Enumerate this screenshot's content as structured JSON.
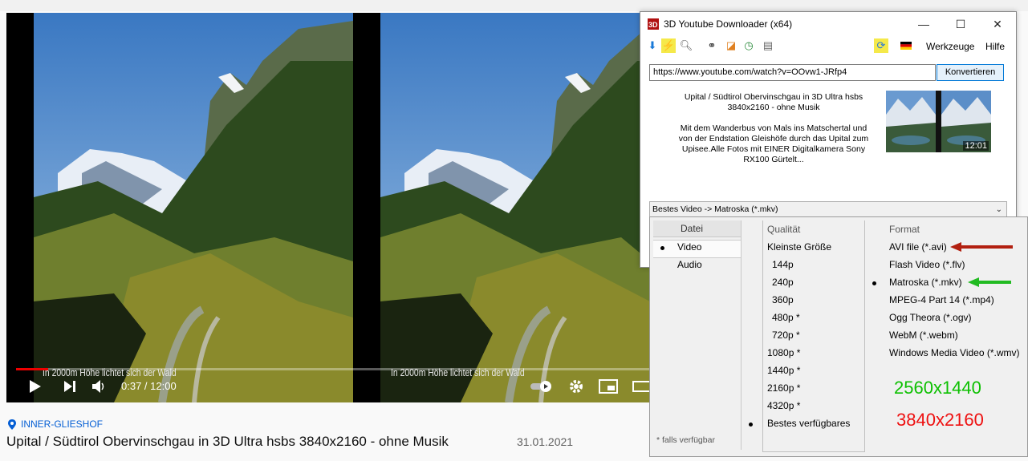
{
  "youtube": {
    "caption": "In 2000m Höhe lichtet sich der Wald",
    "time_display": "0:37 / 12:00",
    "progress": 0.051,
    "location": "INNER-GLIESHOF",
    "title": "Upital / Südtirol Obervinschgau in 3D Ultra hsbs 3840x2160 - ohne Musik",
    "date": "31.01.2021"
  },
  "app": {
    "title": "3D Youtube Downloader (x64)",
    "window_buttons": {
      "minimize": "—",
      "maximize": "☐",
      "close": "✕"
    },
    "menu": {
      "tools": "Werkzeuge",
      "help": "Hilfe"
    },
    "url": "https://www.youtube.com/watch?v=OOvw1-JRfp4",
    "convert_label": "Konvertieren",
    "description_lines": [
      "Upital / Südtirol Obervinschgau in 3D Ultra hsbs",
      "3840x2160 - ohne Musik",
      "",
      "Mit dem Wanderbus von Mals ins Matschertal und",
      "von der Endstation Gleishöfe durch das Upital zum",
      "Upisee.Alle Fotos mit EINER Digitalkamera Sony",
      "RX100 Gürtelt..."
    ],
    "thumb_duration": "12:01",
    "format_selected": "Bestes Video -> Matroska (*.mkv)"
  },
  "dropdown": {
    "datei_header": "Datei",
    "datei_options": [
      "Video",
      "Audio"
    ],
    "datei_selected": "Video",
    "quality_header": "Qualität",
    "quality_options": [
      "Kleinste Größe",
      "144p",
      "240p",
      "360p",
      "480p *",
      "720p *",
      "1080p *",
      "1440p *",
      "2160p *",
      "4320p *",
      "Bestes verfügbares"
    ],
    "quality_selected": "Bestes verfügbares",
    "format_header": "Format",
    "format_options": [
      "AVI file (*.avi)",
      "Flash Video (*.flv)",
      "Matroska (*.mkv)",
      "MPEG-4 Part 14 (*.mp4)",
      "Ogg Theora (*.ogv)",
      "WebM (*.webm)",
      "Windows Media Video (*.wmv)"
    ],
    "format_selected": "Matroska (*.mkv)",
    "note": "* falls verfügbar",
    "annotation_res1": "2560x1440",
    "annotation_res2": "3840x2160"
  },
  "colors": {
    "red_arrow": "#b22010",
    "green_arrow": "#22bb22",
    "res1": "#0cc000",
    "res2": "#ee1111"
  }
}
